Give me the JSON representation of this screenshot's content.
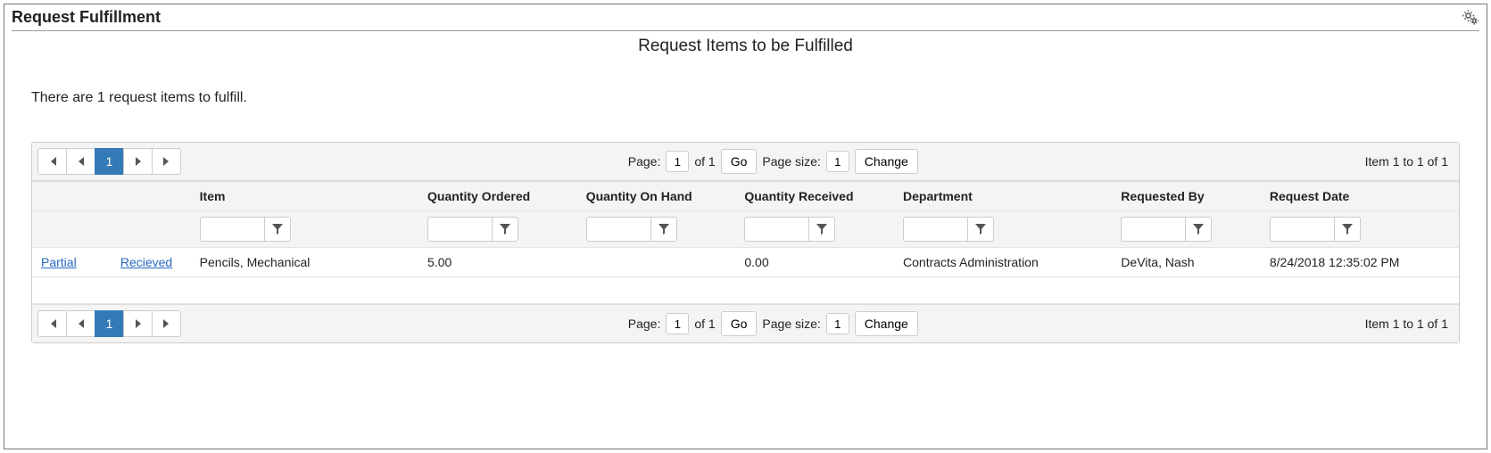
{
  "page": {
    "title": "Request Fulfillment",
    "subtitle": "Request Items to be Fulfilled",
    "info_line": "There are 1 request items to fulfill."
  },
  "pager": {
    "page_label": "Page:",
    "page_value": "1",
    "of_text": "of 1",
    "go_label": "Go",
    "size_label": "Page size:",
    "size_value": "1",
    "change_label": "Change",
    "page_buttons": {
      "current": "1"
    },
    "item_range": "Item 1 to 1 of 1"
  },
  "grid": {
    "headers": {
      "action1": "",
      "action2": "",
      "item": "Item",
      "qty_ordered": "Quantity Ordered",
      "qty_on_hand": "Quantity On Hand",
      "qty_received": "Quantity Received",
      "department": "Department",
      "requested_by": "Requested By",
      "request_date": "Request Date"
    },
    "rows": [
      {
        "action1": "Partial",
        "action2": "Recieved",
        "item": "Pencils, Mechanical",
        "qty_ordered": "5.00",
        "qty_on_hand": "",
        "qty_received": "0.00",
        "department": "Contracts Administration",
        "requested_by": "DeVita, Nash",
        "request_date": "8/24/2018 12:35:02 PM"
      }
    ]
  }
}
